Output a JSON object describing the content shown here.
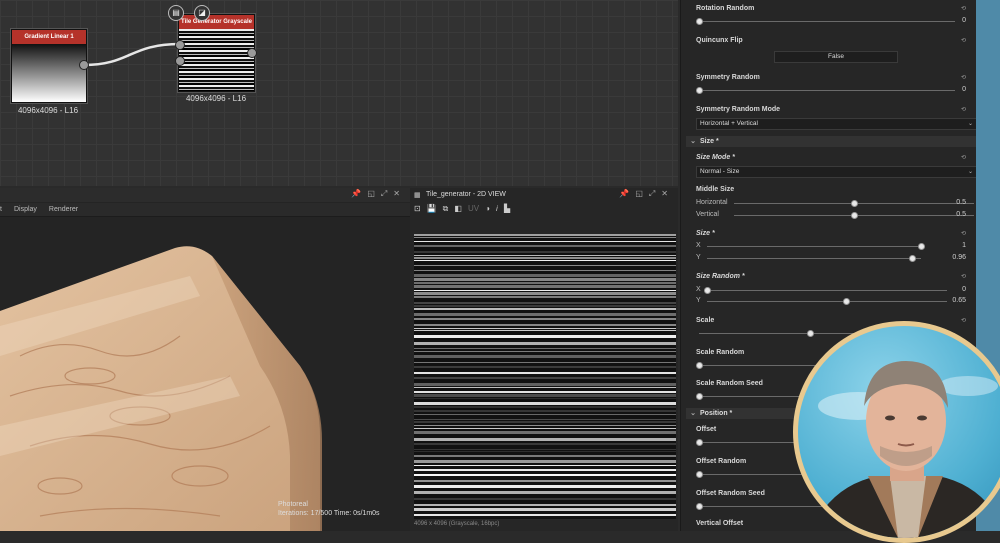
{
  "graph": {
    "nodes": [
      {
        "title": "Gradient Linear 1",
        "resolution": "4096x4096 - L16"
      },
      {
        "title": "Tile Generator Grayscale",
        "resolution": "4096x4096 - L16"
      }
    ]
  },
  "view3d": {
    "tabs": [
      "t",
      "Display",
      "Renderer"
    ],
    "menu": [],
    "status_lines": [
      "Photoreal",
      "Iterations: 17/500     Time: 0s/1m0s"
    ]
  },
  "view2d": {
    "title": "Tile_generator - 2D VIEW",
    "status": "4096 x 4096 (Grayscale, 16bpc)"
  },
  "properties": {
    "rotation_random": {
      "label": "Rotation Random",
      "value": "0",
      "level": 0
    },
    "quincunx_flip": {
      "label": "Quincunx Flip",
      "value": "False"
    },
    "symmetry_random": {
      "label": "Symmetry Random",
      "value": "0",
      "level": 0
    },
    "symmetry_random_mode": {
      "label": "Symmetry Random Mode",
      "value": "Horizontal + Vertical"
    },
    "size_section": {
      "label": "Size *"
    },
    "size_mode": {
      "label": "Size Mode *",
      "value": "Normal - Size"
    },
    "middle_size": {
      "label": "Middle Size",
      "horizontal": {
        "label": "Horizontal",
        "value": "0.5",
        "level": 0.5
      },
      "vertical": {
        "label": "Vertical",
        "value": "0.5",
        "level": 0.5
      }
    },
    "size": {
      "label": "Size *",
      "x": {
        "label": "X",
        "value": "1",
        "level": 1
      },
      "y": {
        "label": "Y",
        "value": "0.96",
        "level": 0.96
      }
    },
    "size_random": {
      "label": "Size Random *",
      "x": {
        "label": "X",
        "value": "0",
        "level": 0
      },
      "y": {
        "label": "Y",
        "value": "0.65",
        "level": 0.65
      }
    },
    "scale": {
      "label": "Scale",
      "level": 0.5
    },
    "scale_random": {
      "label": "Scale Random",
      "level": 0
    },
    "scale_random_seed": {
      "label": "Scale Random Seed",
      "level": 0
    },
    "position_section": {
      "label": "Position *"
    },
    "offset": {
      "label": "Offset",
      "level": 0
    },
    "offset_random": {
      "label": "Offset Random",
      "level": 0
    },
    "offset_random_seed": {
      "label": "Offset Random Seed",
      "level": 0
    },
    "vertical_offset": {
      "label": "Vertical Offset"
    }
  },
  "colors": {
    "node_header": "#b5322a",
    "panel_bg": "#262626",
    "graph_bg": "#323232",
    "webcam_border": "#e8c98f"
  },
  "icons": [
    "pin-icon",
    "restore-icon",
    "maximize-icon",
    "close-icon",
    "reset-icon",
    "chevron-down-icon"
  ]
}
